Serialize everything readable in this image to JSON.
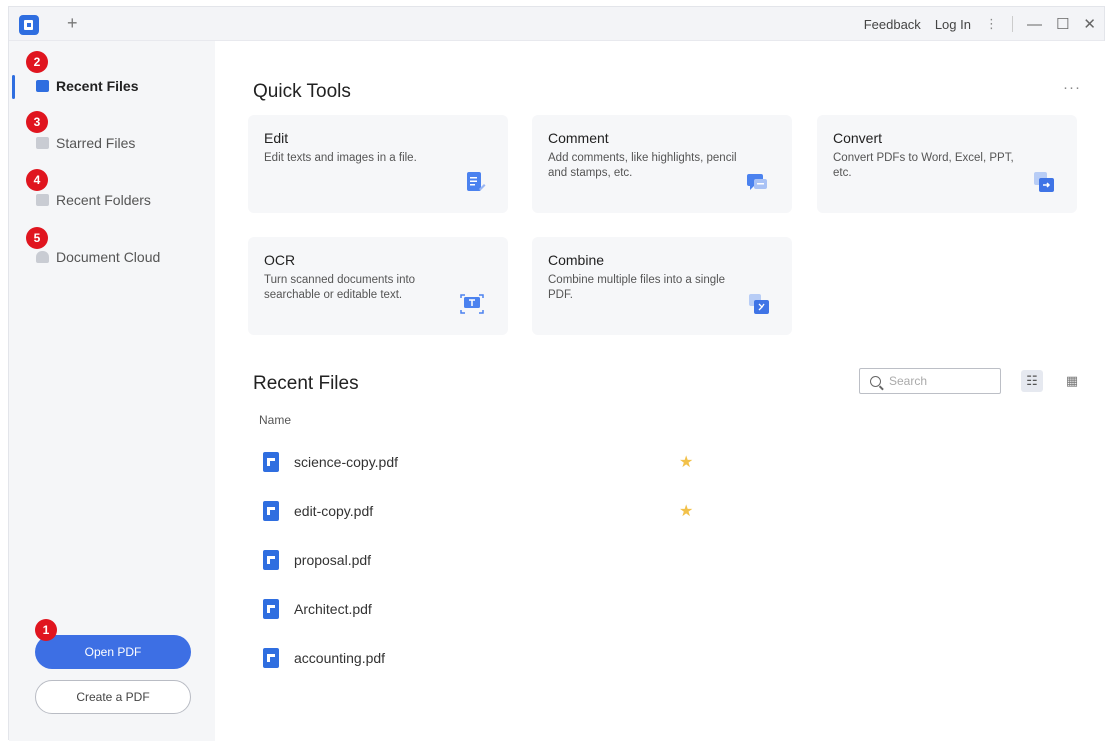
{
  "titlebar": {
    "new_tab": "+",
    "feedback": "Feedback",
    "login": "Log In",
    "menu": "⋮",
    "minimize": "—",
    "maximize": "☐",
    "close": "✕"
  },
  "sidebar": {
    "items": [
      {
        "label": "Recent Files",
        "badge": "2",
        "icon": "recent-files-icon"
      },
      {
        "label": "Starred Files",
        "badge": "3",
        "icon": "star-folder-icon"
      },
      {
        "label": "Recent Folders",
        "badge": "4",
        "icon": "folder-icon"
      },
      {
        "label": "Document Cloud",
        "badge": "5",
        "icon": "cloud-icon"
      }
    ],
    "open_pdf": "Open PDF",
    "open_pdf_badge": "1",
    "create_pdf": "Create a PDF"
  },
  "quick_tools": {
    "title": "Quick Tools",
    "more": "···",
    "cards": [
      {
        "title": "Edit",
        "desc": "Edit texts and images in a file.",
        "icon": "edit-icon"
      },
      {
        "title": "Comment",
        "desc": "Add comments, like highlights, pencil and stamps, etc.",
        "icon": "comment-icon"
      },
      {
        "title": "Convert",
        "desc": "Convert PDFs to Word, Excel, PPT, etc.",
        "icon": "convert-icon"
      },
      {
        "title": "OCR",
        "desc": "Turn scanned documents into searchable or editable text.",
        "icon": "ocr-icon"
      },
      {
        "title": "Combine",
        "desc": "Combine multiple files into a single PDF.",
        "icon": "combine-icon"
      }
    ]
  },
  "recent_files": {
    "title": "Recent Files",
    "search_placeholder": "Search",
    "view_list": "☷",
    "view_grid": "▦",
    "column_name": "Name",
    "files": [
      {
        "name": "science-copy.pdf",
        "starred": "★"
      },
      {
        "name": "edit-copy.pdf",
        "starred": "★"
      },
      {
        "name": "proposal.pdf",
        "starred": ""
      },
      {
        "name": "Architect.pdf",
        "starred": ""
      },
      {
        "name": "accounting.pdf",
        "starred": ""
      }
    ]
  },
  "colors": {
    "accent": "#2f6ee0",
    "badge": "#e0151f",
    "star": "#f2c14a",
    "sidebar_bg": "#f5f6f8",
    "card_bg": "#f6f7f9"
  }
}
